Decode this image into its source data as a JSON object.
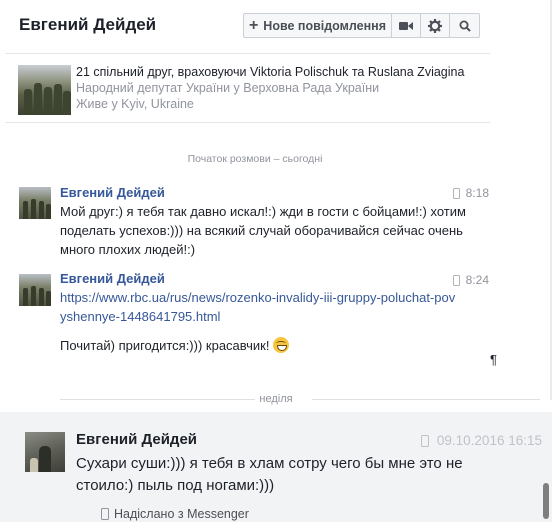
{
  "header": {
    "contact_name": "Евгений Дейдей",
    "new_message_label": "Нове повідомлення",
    "video_icon": "video-camera-icon",
    "settings_icon": "gear-icon",
    "search_icon": "search-icon"
  },
  "profile": {
    "mutual_friends": "21 спільний друг, враховуючи Viktoria Polischuk та Ruslana Zviagina",
    "position": "Народний депутат України у Верховна Рада України",
    "location": "Живе у Kyiv, Ukraine"
  },
  "conversation_start": "Початок розмови – сьогодні",
  "messages": [
    {
      "sender": "Евгений Дейдей",
      "time": "8:18",
      "text": "Мой друг:) я тебя так давно искал!:) жди в гости с бойцами!:) хотим поделать успехов:))) на всякий случай оборачивайся сейчас очень много плохих людей!:)"
    },
    {
      "sender": "Евгений Дейдей",
      "time": "8:24",
      "link": "https://www.rbc.ua/rus/news/rozenko-invalidy-iii-gruppy-poluchat-povyshennye-1448641795.html",
      "text": "Почитай) пригодится:))) красавчик!"
    }
  ],
  "pilcrow": "¶",
  "day_separator": "неділя",
  "last_message": {
    "sender": "Евгений Дейдей",
    "time": "09.10.2016 16:15",
    "text": "Сухари суши:))) я тебя в хлам сотру чего бы мне это не стоило:) пыль под ногами:)))",
    "sent_via": "Надіслано з Messenger"
  },
  "colors": {
    "link": "#365899",
    "muted": "#90949c",
    "highlight_bg": "#f2f3f5"
  }
}
